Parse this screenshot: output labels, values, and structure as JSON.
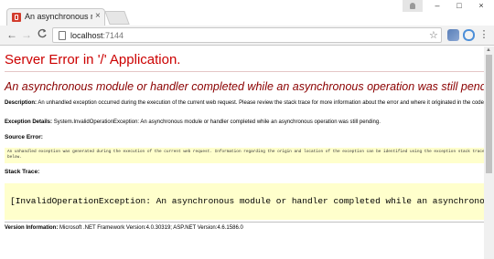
{
  "browser": {
    "tab_title": "An asynchronous modu",
    "tab_close": "×",
    "url_host": "localhost",
    "url_port": ":7144",
    "window_min": "–",
    "window_max": "□",
    "window_close": "×",
    "back": "←",
    "forward": "→",
    "reload": "C",
    "star": "☆",
    "menu": "⋮"
  },
  "page": {
    "title": "Server Error in '/' Application.",
    "error_heading": "An asynchronous module or handler completed while an asynchronous operation was still pending.",
    "description_label": "Description:",
    "description_text": "An unhandled exception occurred during the execution of the current web request. Please review the stack trace for more information about the error and where it originated in the code.",
    "exception_label": "Exception Details:",
    "exception_text": "System.InvalidOperationException: An asynchronous module or handler completed while an asynchronous operation was still pending.",
    "source_error_label": "Source Error:",
    "source_error_text": "An unhandled exception was generated during the execution of the current web request. Information regarding the origin and location of the exception can be identified using the exception stack trace below.",
    "stack_trace_label": "Stack Trace:",
    "stack_trace_text": "[InvalidOperationException: An asynchronous module or handler completed while an asynchronous operation was still pen",
    "version_label": "Version Information:",
    "version_text": "Microsoft .NET Framework Version:4.0.30319; ASP.NET Version:4.6.1586.0"
  },
  "colors": {
    "title_red": "#cc0000",
    "heading_maroon": "#8b0000",
    "code_bg": "#ffffcc"
  },
  "icons": [
    "page-icon",
    "star-icon",
    "menu-icon",
    "back-icon",
    "forward-icon",
    "reload-icon",
    "favicon-icon",
    "user-icon"
  ]
}
